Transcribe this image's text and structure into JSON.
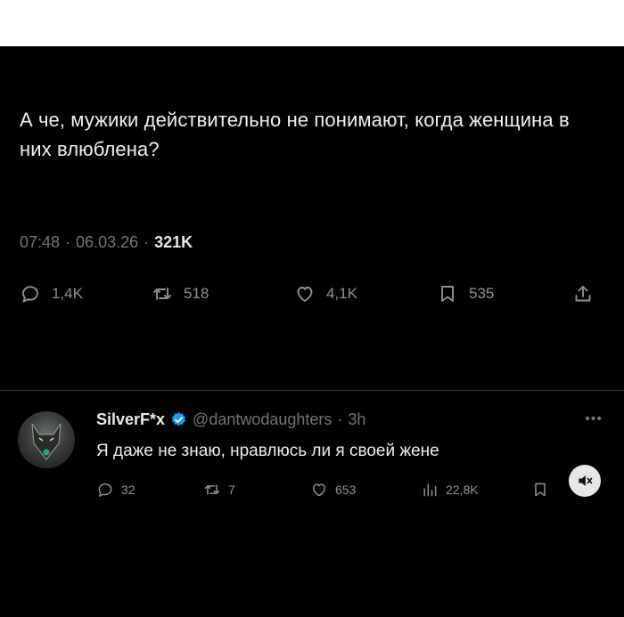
{
  "tweet": {
    "text": "А че, мужики действительно не понимают, когда женщина в них влюблена?",
    "time": "07:48",
    "date": "06.03.26",
    "views": "321K",
    "separator": "·"
  },
  "actions": {
    "replies": "1,4K",
    "reposts": "518",
    "likes": "4,1K",
    "bookmarks": "535"
  },
  "reply": {
    "name": "SilverF*x",
    "handle": "@dantwodaughters",
    "time": "3h",
    "text": "Я даже не знаю, нравлюсь ли я своей жене",
    "replies": "32",
    "reposts": "7",
    "likes": "653",
    "views": "22,8K"
  },
  "colors": {
    "background": "#000000",
    "text": "#e7e9ea",
    "muted": "#71767b",
    "verified": "#1d9bf0"
  }
}
